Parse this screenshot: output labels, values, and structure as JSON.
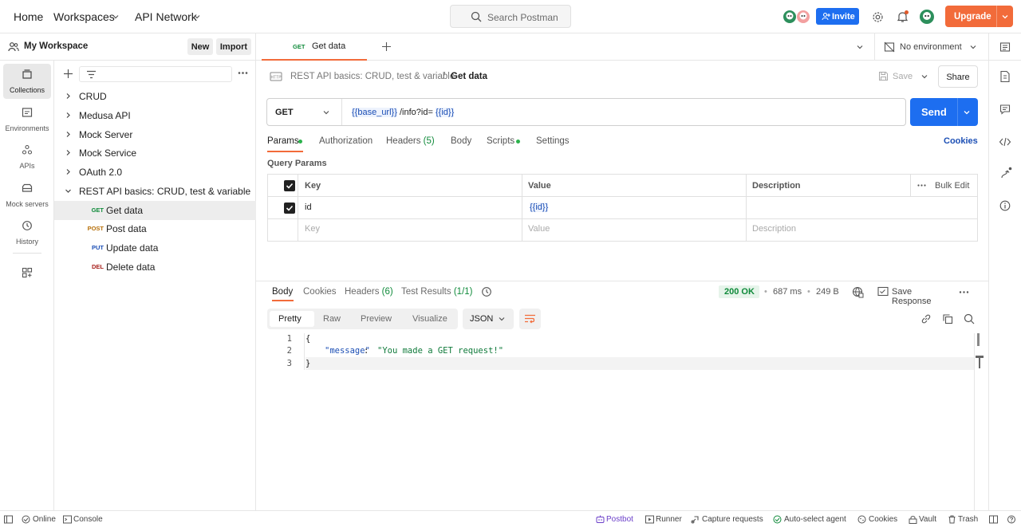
{
  "topbar": {
    "home": "Home",
    "workspaces": "Workspaces",
    "api_network": "API Network",
    "search_placeholder": "Search Postman",
    "invite": "Invite",
    "upgrade": "Upgrade"
  },
  "workspace": {
    "name": "My Workspace",
    "new_button": "New",
    "import_button": "Import"
  },
  "rail": [
    {
      "label": "Collections",
      "icon": "collections-icon",
      "active": true
    },
    {
      "label": "Environments",
      "icon": "environments-icon",
      "active": false
    },
    {
      "label": "APIs",
      "icon": "apis-icon",
      "active": false
    },
    {
      "label": "Mock servers",
      "icon": "mock-servers-icon",
      "active": false
    },
    {
      "label": "History",
      "icon": "history-icon",
      "active": false
    }
  ],
  "collections": [
    {
      "name": "CRUD",
      "expanded": false
    },
    {
      "name": "Medusa API",
      "expanded": false
    },
    {
      "name": "Mock Server",
      "expanded": false
    },
    {
      "name": "Mock Service",
      "expanded": false
    },
    {
      "name": "OAuth 2.0",
      "expanded": false
    },
    {
      "name": "REST API basics: CRUD, test & variable",
      "expanded": true
    }
  ],
  "requests": [
    {
      "method": "GET",
      "name": "Get data",
      "color": "#0f8a3a",
      "selected": true
    },
    {
      "method": "POST",
      "name": "Post data",
      "color": "#b7700a",
      "selected": false
    },
    {
      "method": "PUT",
      "name": "Update data",
      "color": "#1c4fb5",
      "selected": false
    },
    {
      "method": "DEL",
      "name": "Delete data",
      "color": "#a8211d",
      "selected": false
    }
  ],
  "tab": {
    "method": "GET",
    "name": "Get data"
  },
  "environment": "No environment",
  "breadcrumb": {
    "collection": "REST API basics: CRUD, test & variable",
    "separator": "/",
    "request": "Get data"
  },
  "actions": {
    "save": "Save",
    "share": "Share"
  },
  "request": {
    "method": "GET",
    "url_var1": "{{base_url}}",
    "url_path": "/info?id=",
    "url_var2": "{{id}}",
    "send": "Send"
  },
  "req_tabs": {
    "params": "Params",
    "authorization": "Authorization",
    "headers": "Headers",
    "headers_count": "(5)",
    "body": "Body",
    "scripts": "Scripts",
    "settings": "Settings",
    "cookies": "Cookies"
  },
  "query_params": {
    "title": "Query Params",
    "columns": {
      "key": "Key",
      "value": "Value",
      "description": "Description",
      "bulk_edit": "Bulk Edit"
    },
    "rows": [
      {
        "key": "id",
        "value": "{{id}}",
        "description": "",
        "checked": true
      }
    ],
    "placeholder": {
      "key": "Key",
      "value": "Value",
      "description": "Description"
    }
  },
  "response": {
    "tabs": {
      "body": "Body",
      "cookies": "Cookies",
      "headers": "Headers",
      "headers_count": "(6)",
      "tests": "Test Results",
      "tests_count": "(1/1)"
    },
    "status": "200 OK",
    "time": "687 ms",
    "size": "249 B",
    "save_response": "Save Response",
    "views": [
      "Pretty",
      "Raw",
      "Preview",
      "Visualize"
    ],
    "format": "JSON",
    "lines": [
      {
        "n": "1",
        "text": "{"
      },
      {
        "n": "2",
        "key": "\"message\"",
        "colon": ": ",
        "value": "\"You made a GET request!\""
      },
      {
        "n": "3",
        "text": "}"
      }
    ]
  },
  "statusbar": {
    "online": "Online",
    "console": "Console",
    "postbot": "Postbot",
    "runner": "Runner",
    "capture": "Capture requests",
    "autoselect": "Auto-select agent",
    "cookies": "Cookies",
    "vault": "Vault",
    "trash": "Trash"
  },
  "colors": {
    "accent": "#1d6ef0",
    "upgrade": "#f26b3a",
    "status_ok": "#0f8a3a",
    "active_tab": "#f26b3a"
  }
}
